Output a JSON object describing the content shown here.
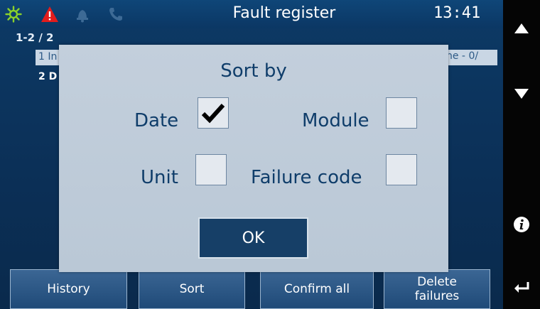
{
  "status": {
    "title": "Fault register",
    "time": "13:41",
    "icons": [
      "gear-icon",
      "warning-icon",
      "bell-icon",
      "phone-icon"
    ]
  },
  "list": {
    "counter": "1-2 / 2",
    "rows": [
      {
        "text": "1 In",
        "tail": "ne - 0/"
      },
      {
        "text": "2 D"
      }
    ]
  },
  "dialog": {
    "title": "Sort by",
    "options": {
      "date": {
        "label": "Date",
        "checked": true
      },
      "module": {
        "label": "Module",
        "checked": false
      },
      "unit": {
        "label": "Unit",
        "checked": false
      },
      "failure": {
        "label": "Failure code",
        "checked": false
      }
    },
    "ok_label": "OK"
  },
  "softkeys": [
    "History",
    "Sort",
    "Confirm all",
    "Delete\nfailures"
  ],
  "rail": [
    "up-arrow-icon",
    "down-arrow-icon",
    "info-icon",
    "back-icon"
  ],
  "colors": {
    "background": "#0b3764",
    "dialog": "#bac8d6",
    "accent": "#0f3d6a",
    "warning": "#e31c1c",
    "gear": "#8bd12a"
  }
}
